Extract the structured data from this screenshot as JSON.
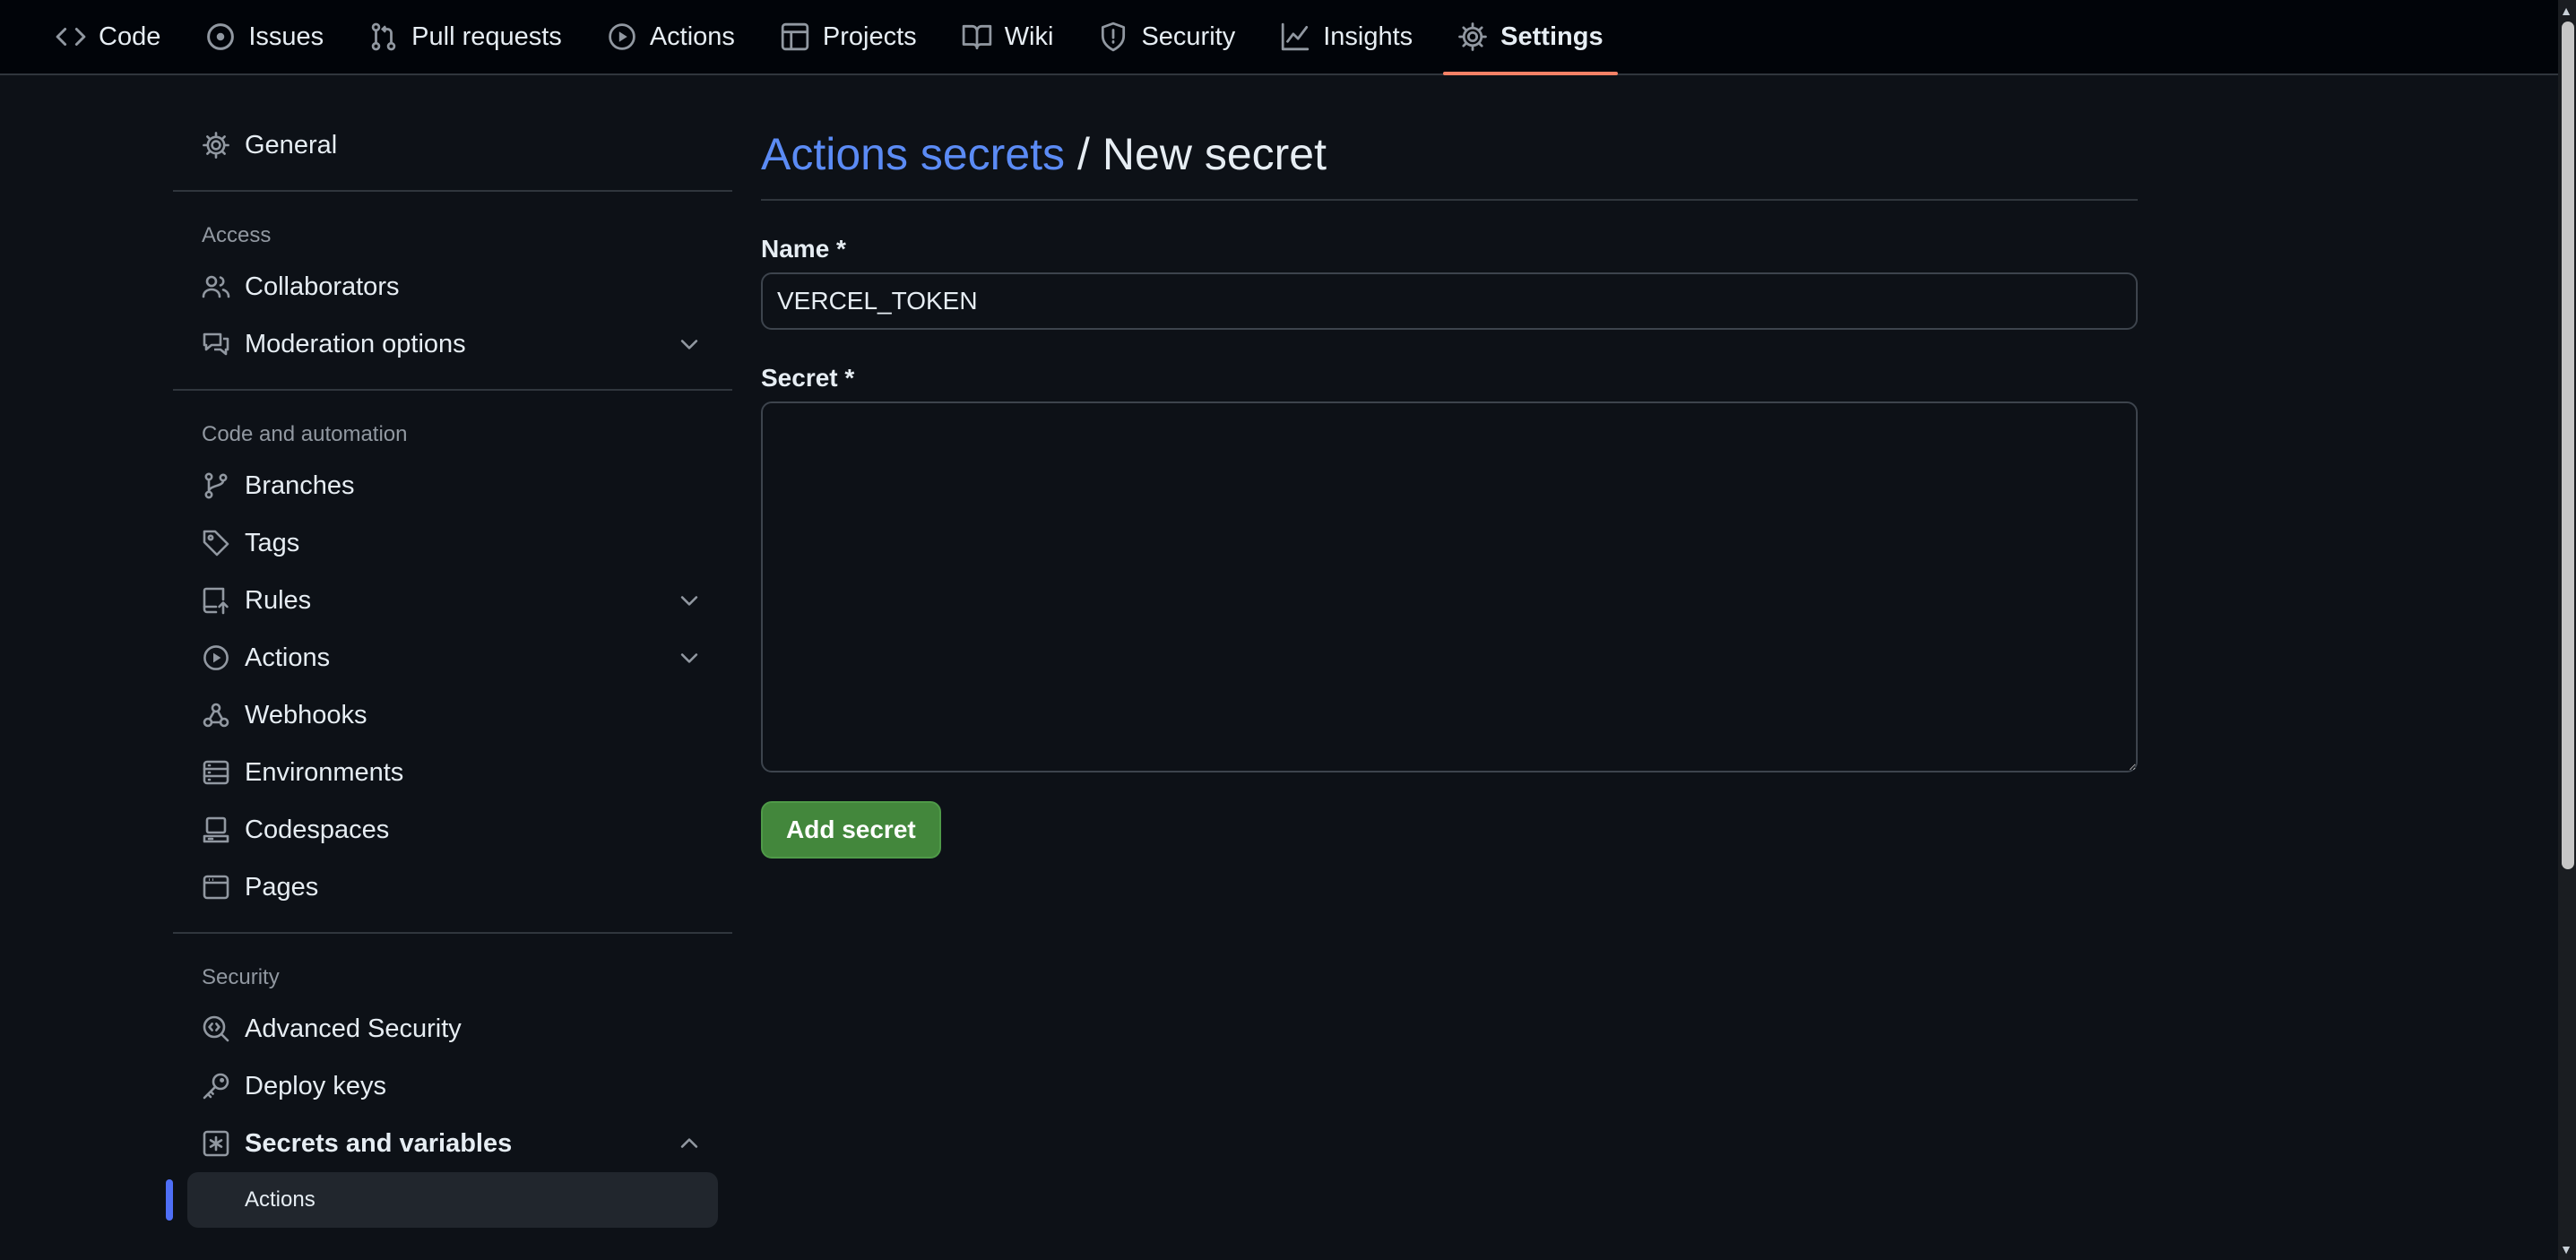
{
  "repo_nav": {
    "tabs": [
      {
        "label": "Code",
        "icon": "code-icon"
      },
      {
        "label": "Issues",
        "icon": "issue-circle-icon"
      },
      {
        "label": "Pull requests",
        "icon": "pull-request-icon"
      },
      {
        "label": "Actions",
        "icon": "play-circle-icon"
      },
      {
        "label": "Projects",
        "icon": "table-icon"
      },
      {
        "label": "Wiki",
        "icon": "book-icon"
      },
      {
        "label": "Security",
        "icon": "shield-icon"
      },
      {
        "label": "Insights",
        "icon": "graph-icon"
      },
      {
        "label": "Settings",
        "icon": "gear-icon",
        "selected": true
      }
    ]
  },
  "sidebar": {
    "general": "General",
    "access": {
      "title": "Access",
      "items": [
        "Collaborators",
        "Moderation options"
      ]
    },
    "code_automation": {
      "title": "Code and automation",
      "items": [
        "Branches",
        "Tags",
        "Rules",
        "Actions",
        "Webhooks",
        "Environments",
        "Codespaces",
        "Pages"
      ]
    },
    "security": {
      "title": "Security",
      "items": [
        "Advanced Security",
        "Deploy keys",
        "Secrets and variables"
      ],
      "sub_items": [
        "Actions"
      ]
    }
  },
  "main": {
    "breadcrumb_link": "Actions secrets",
    "breadcrumb_sep": "/",
    "breadcrumb_current": "New secret",
    "name_label": "Name *",
    "name_value": "VERCEL_TOKEN",
    "secret_label": "Secret *",
    "secret_value": "",
    "submit_label": "Add secret"
  },
  "colors": {
    "background": "#0d1117",
    "nav_background": "#010409",
    "link": "#5b8bf5",
    "selected_tab_underline": "#f78166",
    "primary_button": "#43873c",
    "active_indicator": "#4f6ff7"
  }
}
